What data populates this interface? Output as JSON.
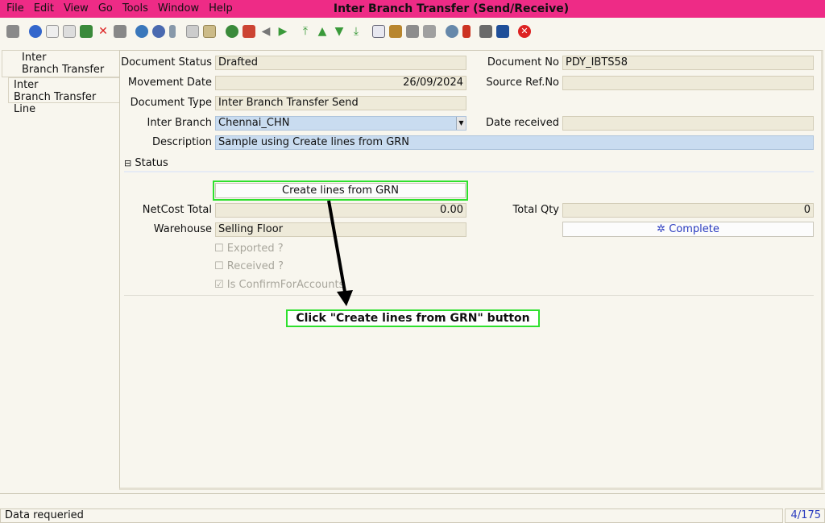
{
  "menu": [
    "File",
    "Edit",
    "View",
    "Go",
    "Tools",
    "Window",
    "Help"
  ],
  "window_title": "Inter Branch Transfer (Send/Receive)",
  "tabs": {
    "header_line1": "Inter",
    "header_line2": "Branch Transfer",
    "line_line1": "Inter",
    "line_line2": "Branch Transfer Line"
  },
  "form": {
    "document_status": {
      "label": "Document Status",
      "value": "Drafted"
    },
    "document_no": {
      "label": "Document No",
      "value": "PDY_IBTS58"
    },
    "movement_date": {
      "label": "Movement Date",
      "value": "26/09/2024"
    },
    "source_ref": {
      "label": "Source Ref.No",
      "value": ""
    },
    "document_type": {
      "label": "Document Type",
      "value": "Inter Branch Transfer Send"
    },
    "inter_branch": {
      "label": "Inter Branch",
      "value": "Chennai_CHN"
    },
    "date_received": {
      "label": "Date received",
      "value": ""
    },
    "description": {
      "label": "Description",
      "value": "Sample using Create lines from GRN"
    }
  },
  "status_section": {
    "title": "Status",
    "create_lines_button": "Create lines from GRN",
    "netcost_total": {
      "label": "NetCost Total",
      "value": "0.00"
    },
    "total_qty": {
      "label": "Total Qty",
      "value": "0"
    },
    "warehouse": {
      "label": "Warehouse",
      "value": "Selling Floor"
    },
    "complete_button": "Complete",
    "exported": {
      "label": "Exported ?",
      "checked": false
    },
    "received": {
      "label": "Received ?",
      "checked": false
    },
    "confirm_for_accounts": {
      "label": "Is ConfirmForAccounts",
      "checked": true
    }
  },
  "annotation": "Click \"Create lines from GRN\" button",
  "status_bar": {
    "message": "Data requeried",
    "pager": "4/175"
  },
  "colors": {
    "title_bar": "#ee2b86",
    "highlight": "#2ee02e",
    "accent_blue": "#2a3bbf",
    "field_bg": "#eeead9",
    "field_blue": "#c9dcf0"
  }
}
